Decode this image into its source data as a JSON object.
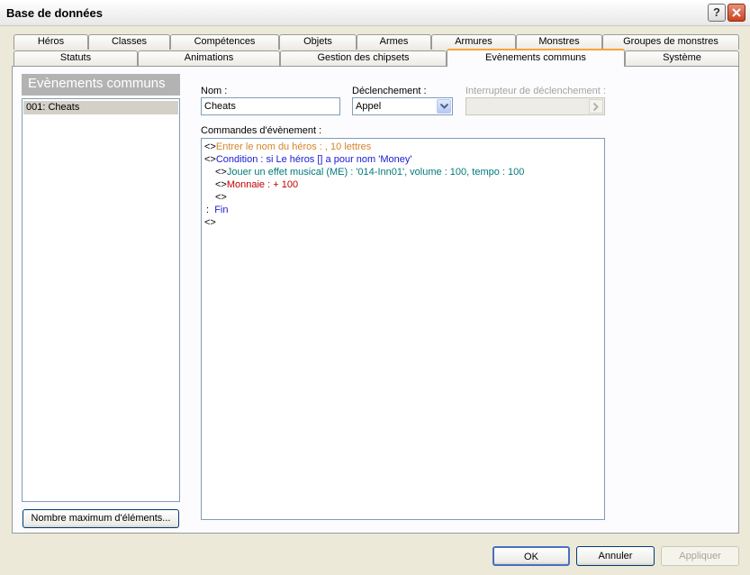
{
  "window": {
    "title": "Base de données"
  },
  "tabs_row1": [
    "Héros",
    "Classes",
    "Compétences",
    "Objets",
    "Armes",
    "Armures",
    "Monstres",
    "Groupes de monstres"
  ],
  "tabs_row2": [
    "Statuts",
    "Animations",
    "Gestion des chipsets",
    "Evènements communs",
    "Système"
  ],
  "active_tab": "Evènements communs",
  "left": {
    "header": "Evènements communs",
    "items": [
      "001: Cheats"
    ],
    "max_button": "Nombre maximum d'éléments..."
  },
  "form": {
    "name_label": "Nom :",
    "name_value": "Cheats",
    "trigger_label": "Déclenchement :",
    "trigger_value": "Appel",
    "switch_label": "Interrupteur de déclenchement :",
    "commands_label": "Commandes d'évènement :"
  },
  "commands": [
    {
      "prefix": "<>",
      "text": "Entrer le nom du héros : , 10 lettres",
      "color": "#d4852b"
    },
    {
      "prefix": "<>",
      "text": "Condition : si Le héros [] a pour nom 'Money'",
      "color": "#1a1ad4"
    },
    {
      "prefix": "<>",
      "text": "Jouer un effet musical (ME) : '014-Inn01', volume : 100, tempo : 100",
      "color": "#007a7a"
    },
    {
      "prefix": "<>",
      "text": "Monnaie : + 100",
      "color": "#c00000"
    },
    {
      "prefix": "<>",
      "text": "",
      "color": "#000000"
    },
    {
      "prefix": ":",
      "text": "Fin",
      "color": "#1a1ad4"
    },
    {
      "prefix": "<>",
      "text": "",
      "color": "#000000"
    }
  ],
  "buttons": {
    "ok": "OK",
    "cancel": "Annuler",
    "apply": "Appliquer"
  }
}
